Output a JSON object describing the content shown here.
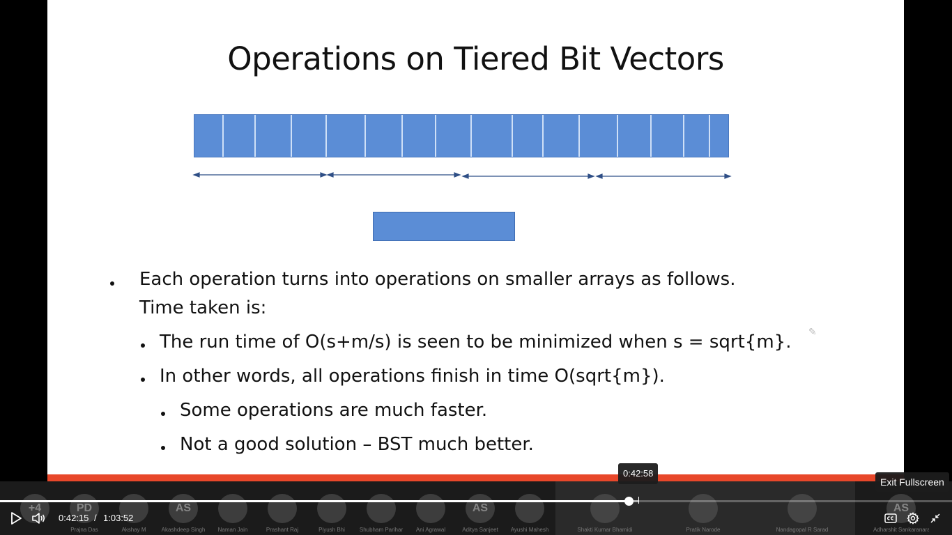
{
  "slide": {
    "title": "Operations on Tiered Bit Vectors",
    "bullets": [
      {
        "level": 1,
        "lines": [
          "Each operation turns into operations on smaller arrays as follows.",
          "Time taken is:"
        ]
      },
      {
        "level": 2,
        "lines": [
          "The run time of O(s+m/s) is seen to be minimized when s = sqrt{m}."
        ]
      },
      {
        "level": 2,
        "lines": [
          "In other words, all operations finish in time O(sqrt{m})."
        ]
      },
      {
        "level": 3,
        "lines": [
          "Some operations are much faster."
        ]
      },
      {
        "level": 3,
        "lines": [
          "Not a good solution – BST much better."
        ]
      }
    ]
  },
  "player": {
    "current_time": "0:42:15",
    "separator": "/",
    "duration": "1:03:52",
    "hover_time": "0:42:58",
    "progress_fraction": 0.6601,
    "exit_fullscreen_tooltip": "Exit Fullscreen"
  },
  "participants": [
    {
      "initials": "+4",
      "name": ""
    },
    {
      "initials": "PD",
      "name": "Prajna Das"
    },
    {
      "initials": "",
      "name": "Akshay M"
    },
    {
      "initials": "AS",
      "name": "Akashdeep Singh"
    },
    {
      "initials": "",
      "name": "Naman Jain"
    },
    {
      "initials": "",
      "name": "Prashant Raj"
    },
    {
      "initials": "",
      "name": "Piyush Bhi"
    },
    {
      "initials": "",
      "name": "Shubham Parihar"
    },
    {
      "initials": "",
      "name": "Ani Agrawal"
    },
    {
      "initials": "AS",
      "name": "Aditya Sanjeet"
    },
    {
      "initials": "",
      "name": "Ayushi Mahesh"
    },
    {
      "initials": "",
      "name": "Shakti Kumar Bhamidi"
    },
    {
      "initials": "",
      "name": "Pratik Narode"
    },
    {
      "initials": "",
      "name": "Nandagopal R Sarad"
    },
    {
      "initials": "AS",
      "name": "Adharshit Sankaranaram"
    }
  ],
  "colors": {
    "array_fill": "#5b8dd6",
    "accent_bar": "#e8472a",
    "arrow": "#2f4f86"
  }
}
